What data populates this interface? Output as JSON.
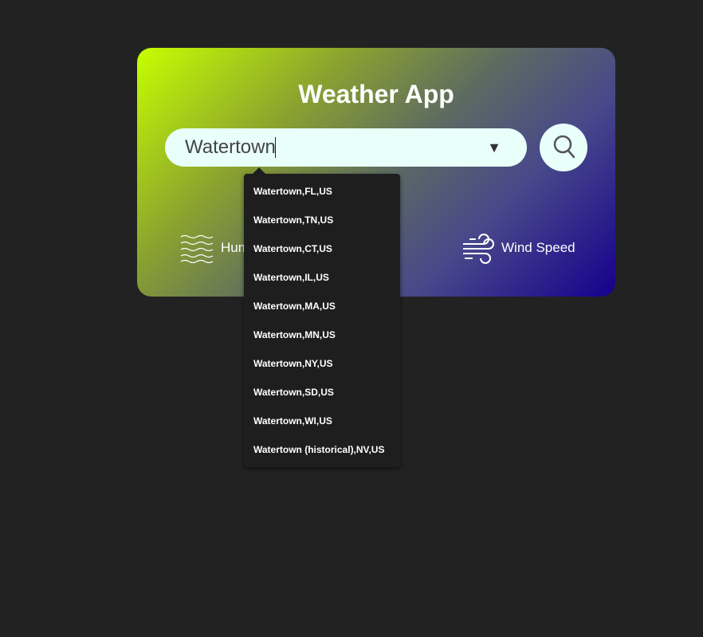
{
  "app": {
    "title": "Weather App"
  },
  "search": {
    "value": "Watertown",
    "dropdown_icon": "triangle-down-icon",
    "button_icon": "search-icon"
  },
  "details": {
    "humidity_label": "Hum",
    "humidity_icon": "waves-icon",
    "wind_label": "Wind Speed",
    "wind_icon": "wind-icon"
  },
  "suggestions": [
    "Watertown,FL,US",
    "Watertown,TN,US",
    "Watertown,CT,US",
    "Watertown,IL,US",
    "Watertown,MA,US",
    "Watertown,MN,US",
    "Watertown,NY,US",
    "Watertown,SD,US",
    "Watertown,WI,US",
    "Watertown (historical),NV,US"
  ],
  "colors": {
    "background": "#222222",
    "input_bg": "#e8fffa",
    "gradient_start": "#c6ff00",
    "gradient_end": "#16008c",
    "dropdown_bg": "#1e1e1e"
  }
}
